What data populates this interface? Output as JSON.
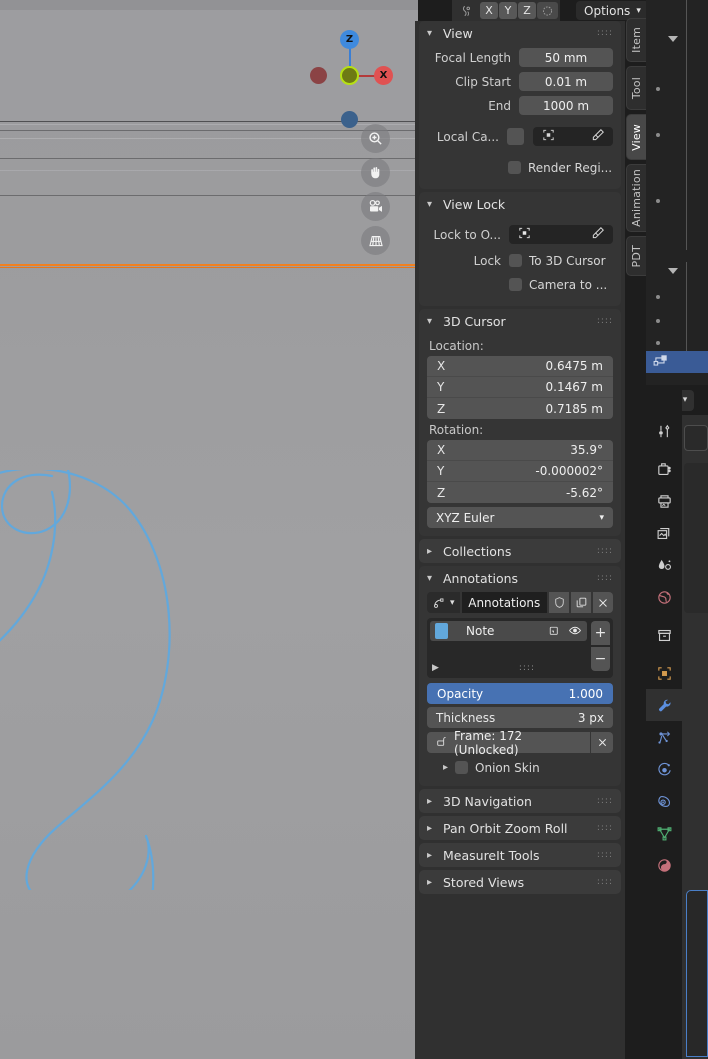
{
  "app": {
    "name": "Blender 3D Viewport"
  },
  "header": {
    "mode_icon": "proportional-edit-icon",
    "axis_buttons": [
      "X",
      "Y",
      "Z"
    ],
    "snap_icon": "rotate-snap-icon",
    "options_label": "Options",
    "options_caret": "chevron-down-icon"
  },
  "viewport": {
    "gizmo": {
      "x_label": "X",
      "z_label": "Z"
    },
    "buttons": [
      {
        "name": "zoom-icon",
        "label": "Zoom"
      },
      {
        "name": "hand-icon",
        "label": "Move View"
      },
      {
        "name": "camera-icon",
        "label": "Camera View"
      },
      {
        "name": "grid-perspective-icon",
        "label": "Toggle Perspective/Ortho"
      }
    ],
    "annotation_color": "#62a8dc",
    "active_object_color": "#f08020"
  },
  "tabs": [
    {
      "label": "Item",
      "active": false
    },
    {
      "label": "Tool",
      "active": false
    },
    {
      "label": "View",
      "active": true
    },
    {
      "label": "Animation",
      "active": false
    },
    {
      "label": "PDT",
      "active": false
    }
  ],
  "sidebar": {
    "view": {
      "title": "View",
      "focal_length": {
        "label": "Focal Length",
        "value": "50 mm"
      },
      "clip_start": {
        "label": "Clip Start",
        "value": "0.01 m"
      },
      "clip_end": {
        "label": "End",
        "value": "1000 m"
      },
      "local_camera": {
        "label": "Local Ca...",
        "value": "",
        "eyedropper": "eyedropper-icon"
      },
      "render_region": {
        "label": "Render Regi...",
        "checked": false
      }
    },
    "view_lock": {
      "title": "View Lock",
      "lock_to_object": {
        "label": "Lock to O...",
        "value": ""
      },
      "lock_label": "Lock",
      "to_3d_cursor": {
        "label": "To 3D Cursor",
        "checked": false
      },
      "camera_to_view": {
        "label": "Camera to ...",
        "checked": false
      }
    },
    "cursor3d": {
      "title": "3D Cursor",
      "location_label": "Location:",
      "location": [
        {
          "axis": "X",
          "value": "0.6475 m"
        },
        {
          "axis": "Y",
          "value": "0.1467 m"
        },
        {
          "axis": "Z",
          "value": "0.7185 m"
        }
      ],
      "rotation_label": "Rotation:",
      "rotation": [
        {
          "axis": "X",
          "value": "35.9°"
        },
        {
          "axis": "Y",
          "value": "-0.000002°"
        },
        {
          "axis": "Z",
          "value": "-5.62°"
        }
      ],
      "rotation_mode": "XYZ Euler"
    },
    "collections": {
      "title": "Collections",
      "expanded": false
    },
    "annotations": {
      "title": "Annotations",
      "expanded": true,
      "datablock_name": "Annotations",
      "shield_icon": "shield-icon",
      "copy_icon": "duplicate-icon",
      "close_icon": "close-icon",
      "layers": [
        {
          "name": "Note",
          "color": "#62a8dc",
          "mask_icon": "onion-icon",
          "visible_icon": "eye-icon"
        }
      ],
      "add_label": "+",
      "remove_label": "−",
      "opacity": {
        "label": "Opacity",
        "value": "1.000",
        "fill": 100,
        "color": "#4772b3"
      },
      "thickness": {
        "label": "Thickness",
        "value": "3 px"
      },
      "frame": {
        "label": "Frame: 172 (Unlocked)",
        "lock_icon": "unlock-icon",
        "close_icon": "close-icon"
      },
      "onion_skin": {
        "label": "Onion Skin",
        "checked": false,
        "expanded": false
      }
    },
    "closed_panels": [
      {
        "title": "3D Navigation"
      },
      {
        "title": "Pan Orbit Zoom Roll"
      },
      {
        "title": "MeasureIt Tools"
      },
      {
        "title": "Stored Views"
      }
    ]
  },
  "outliner": {
    "rows": [
      {
        "type": "blank"
      },
      {
        "type": "disclosure"
      },
      {
        "type": "blank"
      },
      {
        "type": "dot"
      },
      {
        "type": "blank"
      },
      {
        "type": "dot"
      },
      {
        "type": "blank"
      },
      {
        "type": "blank"
      },
      {
        "type": "dot"
      },
      {
        "type": "blank"
      },
      {
        "type": "blank"
      },
      {
        "type": "disclosure"
      },
      {
        "type": "dot"
      },
      {
        "type": "dot"
      },
      {
        "type": "dot"
      },
      {
        "type": "selected",
        "icon": "empty-axes-icon"
      }
    ]
  },
  "properties": {
    "header_icon": "editor-type-icon",
    "tabs": [
      {
        "name": "tool-icon",
        "active": false,
        "color": "#cfcfcf"
      },
      {
        "name": "render-icon",
        "active": false,
        "color": "#cfcfcf"
      },
      {
        "name": "output-icon",
        "active": false,
        "color": "#cfcfcf"
      },
      {
        "name": "view-layer-icon",
        "active": false,
        "color": "#cfcfcf"
      },
      {
        "name": "scene-icon",
        "active": false,
        "color": "#cfcfcf"
      },
      {
        "name": "world-icon",
        "active": false,
        "color": "#c4707a"
      },
      {
        "name": "collection-icon",
        "active": false,
        "color": "#cfcfcf"
      },
      {
        "name": "object-icon",
        "active": false,
        "color": "#d39a4e"
      },
      {
        "name": "modifier-wrench-icon",
        "active": true,
        "color": "#5b8fe0"
      },
      {
        "name": "particles-icon",
        "active": false,
        "color": "#6e93d6"
      },
      {
        "name": "physics-icon",
        "active": false,
        "color": "#6e93d6"
      },
      {
        "name": "constraints-icon",
        "active": false,
        "color": "#6e93d6"
      },
      {
        "name": "data-mesh-icon",
        "active": false,
        "color": "#4fae72"
      },
      {
        "name": "material-icon",
        "active": false,
        "color": "#c4707a"
      }
    ]
  }
}
